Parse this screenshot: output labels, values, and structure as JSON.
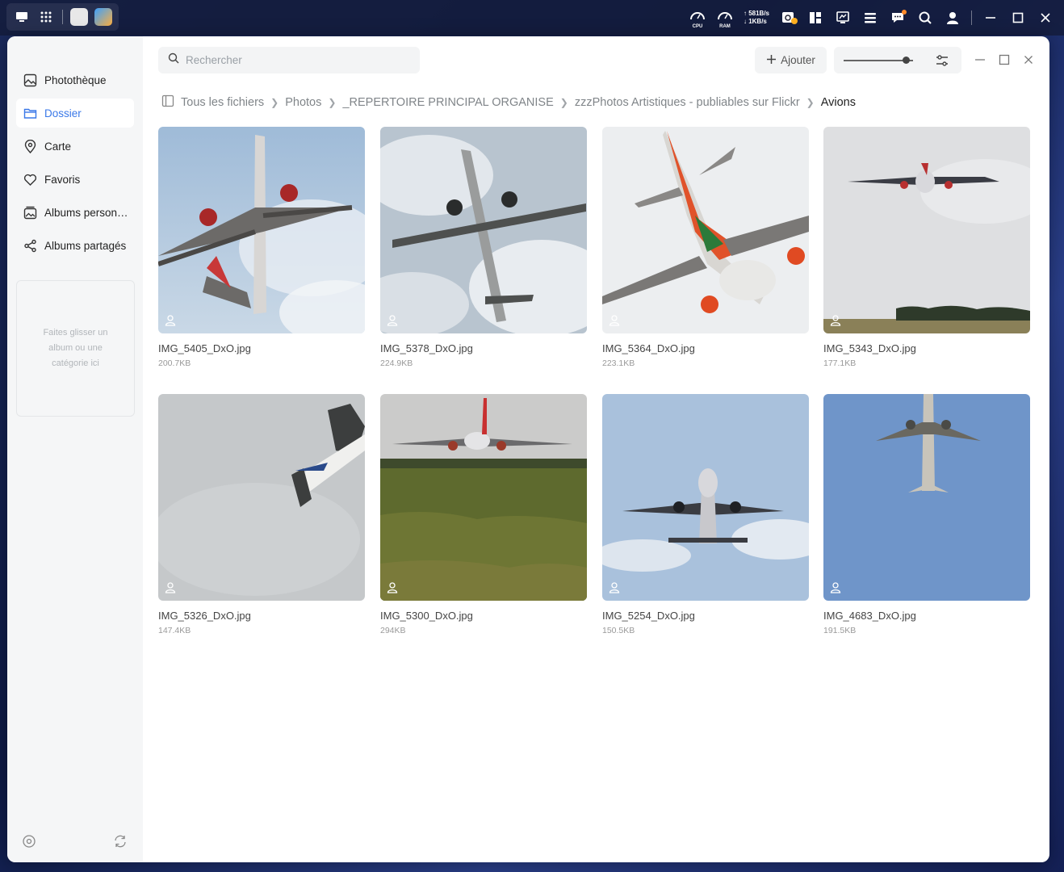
{
  "system_bar": {
    "cpu_label": "CPU",
    "ram_label": "RAM",
    "upload_speed": "581B/s",
    "download_speed": "1KB/s",
    "icons": [
      "desktop-icon",
      "apps-grid-icon",
      "app-tile-1",
      "app-tile-2",
      "cpu-gauge-icon",
      "ram-gauge-icon",
      "sync-icon",
      "panel-icon",
      "monitor-icon",
      "tasks-icon",
      "chat-icon",
      "search-icon",
      "user-icon",
      "minimize-icon",
      "maximize-icon",
      "close-icon"
    ],
    "notification_color": "#ff8a2a"
  },
  "sidebar": {
    "items": [
      {
        "label": "Photothèque",
        "icon": "photo-library-icon",
        "active": false
      },
      {
        "label": "Dossier",
        "icon": "folder-icon",
        "active": true
      },
      {
        "label": "Carte",
        "icon": "map-pin-icon",
        "active": false
      },
      {
        "label": "Favoris",
        "icon": "heart-icon",
        "active": false
      },
      {
        "label": "Albums person…",
        "icon": "album-icon",
        "active": false
      },
      {
        "label": "Albums partagés",
        "icon": "share-icon",
        "active": false
      }
    ],
    "dropzone_text": "Faites glisser un album ou une catégorie ici",
    "accent_color": "#3a78e8"
  },
  "toolbar": {
    "search_placeholder": "Rechercher",
    "add_label": "Ajouter",
    "zoom_level": 0.9
  },
  "breadcrumb": {
    "items": [
      "Tous les fichiers",
      "Photos",
      "_REPERTOIRE PRINCIPAL ORGANISE",
      "zzzPhotos Artistiques - publiables sur Flickr"
    ],
    "current": "Avions"
  },
  "photos": [
    {
      "name": "IMG_5405_DxO.jpg",
      "size": "200.7KB",
      "scene": "sky-cloudy-blue"
    },
    {
      "name": "IMG_5378_DxO.jpg",
      "size": "224.9KB",
      "scene": "sky-cloudy"
    },
    {
      "name": "IMG_5364_DxO.jpg",
      "size": "223.1KB",
      "scene": "sky-white"
    },
    {
      "name": "IMG_5343_DxO.jpg",
      "size": "177.1KB",
      "scene": "sky-trees"
    },
    {
      "name": "IMG_5326_DxO.jpg",
      "size": "147.4KB",
      "scene": "sky-grey"
    },
    {
      "name": "IMG_5300_DxO.jpg",
      "size": "294KB",
      "scene": "runway-grass"
    },
    {
      "name": "IMG_5254_DxO.jpg",
      "size": "150.5KB",
      "scene": "sky-blue-clouds"
    },
    {
      "name": "IMG_4683_DxO.jpg",
      "size": "191.5KB",
      "scene": "sky-blue"
    }
  ]
}
